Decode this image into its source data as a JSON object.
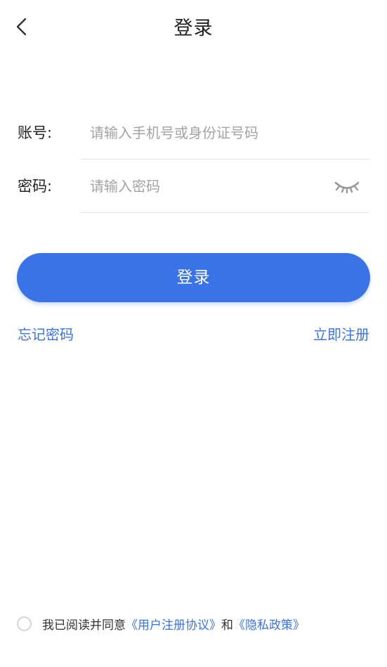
{
  "header": {
    "title": "登录",
    "back_icon": "chevron-left-icon"
  },
  "form": {
    "account": {
      "label": "账号:",
      "placeholder": "请输入手机号或身份证号码",
      "value": ""
    },
    "password": {
      "label": "密码:",
      "placeholder": "请输入密码",
      "value": "",
      "toggle_icon": "eye-closed-icon"
    }
  },
  "login_button": {
    "label": "登录"
  },
  "links": {
    "forgot": "忘记密码",
    "register": "立即注册"
  },
  "agreement": {
    "prefix": "我已阅读并同意",
    "user_agreement": "《用户注册协议》",
    "conjunction": "和",
    "privacy_policy": "《隐私政策》",
    "checked": false
  },
  "colors": {
    "accent": "#3a73e8",
    "placeholder": "#a3a3a3",
    "divider": "#e3e3e3"
  }
}
